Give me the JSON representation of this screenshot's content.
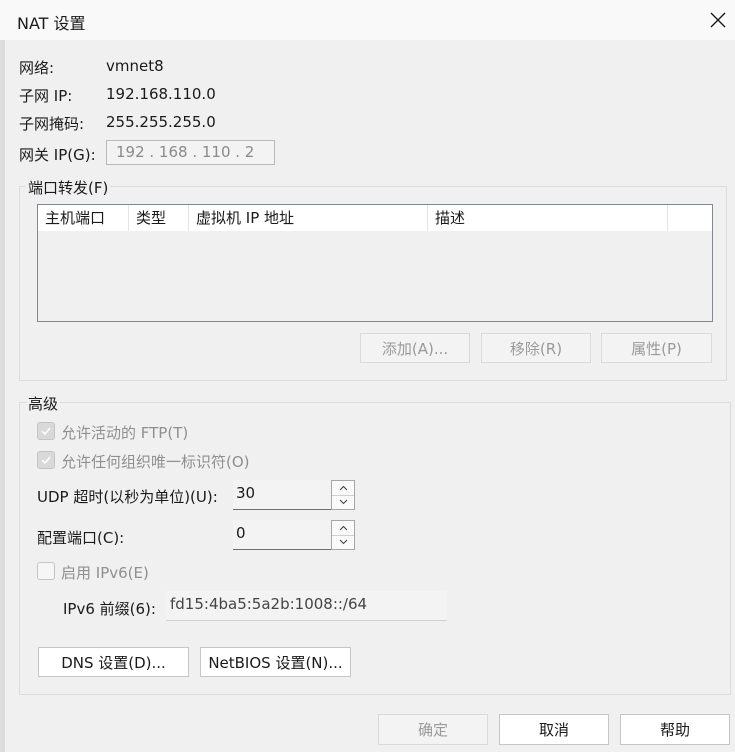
{
  "window": {
    "title": "NAT 设置"
  },
  "info": {
    "network_label": "网络:",
    "network_value": "vmnet8",
    "subnet_ip_label": "子网 IP:",
    "subnet_ip_value": "192.168.110.0",
    "subnet_mask_label": "子网掩码:",
    "subnet_mask_value": "255.255.255.0",
    "gateway_label": "网关 IP(G):",
    "gateway_value": "192 . 168 . 110 .  2"
  },
  "port_forwarding": {
    "title": "端口转发(F)",
    "columns": [
      "主机端口",
      "类型",
      "虚拟机 IP 地址",
      "描述"
    ],
    "rows": [],
    "add_label": "添加(A)...",
    "remove_label": "移除(R)",
    "properties_label": "属性(P)"
  },
  "advanced": {
    "title": "高级",
    "allow_ftp_label": "允许活动的 FTP(T)",
    "allow_ftp_checked": true,
    "allow_oui_label": "允许任何组织唯一标识符(O)",
    "allow_oui_checked": true,
    "udp_timeout_label": "UDP 超时(以秒为单位)(U):",
    "udp_timeout_value": "30",
    "config_port_label": "配置端口(C):",
    "config_port_value": "0",
    "enable_ipv6_label": "启用 IPv6(E)",
    "enable_ipv6_checked": false,
    "ipv6_prefix_label": "IPv6 前缀(6):",
    "ipv6_prefix_value": "fd15:4ba5:5a2b:1008::/64",
    "dns_label": "DNS 设置(D)...",
    "netbios_label": "NetBIOS 设置(N)..."
  },
  "footer": {
    "ok_label": "确定",
    "cancel_label": "取消",
    "help_label": "帮助"
  },
  "icons": {
    "close": "close-icon",
    "check": "check-icon",
    "spin_up": "chevron-up-icon",
    "spin_down": "chevron-down-icon"
  }
}
